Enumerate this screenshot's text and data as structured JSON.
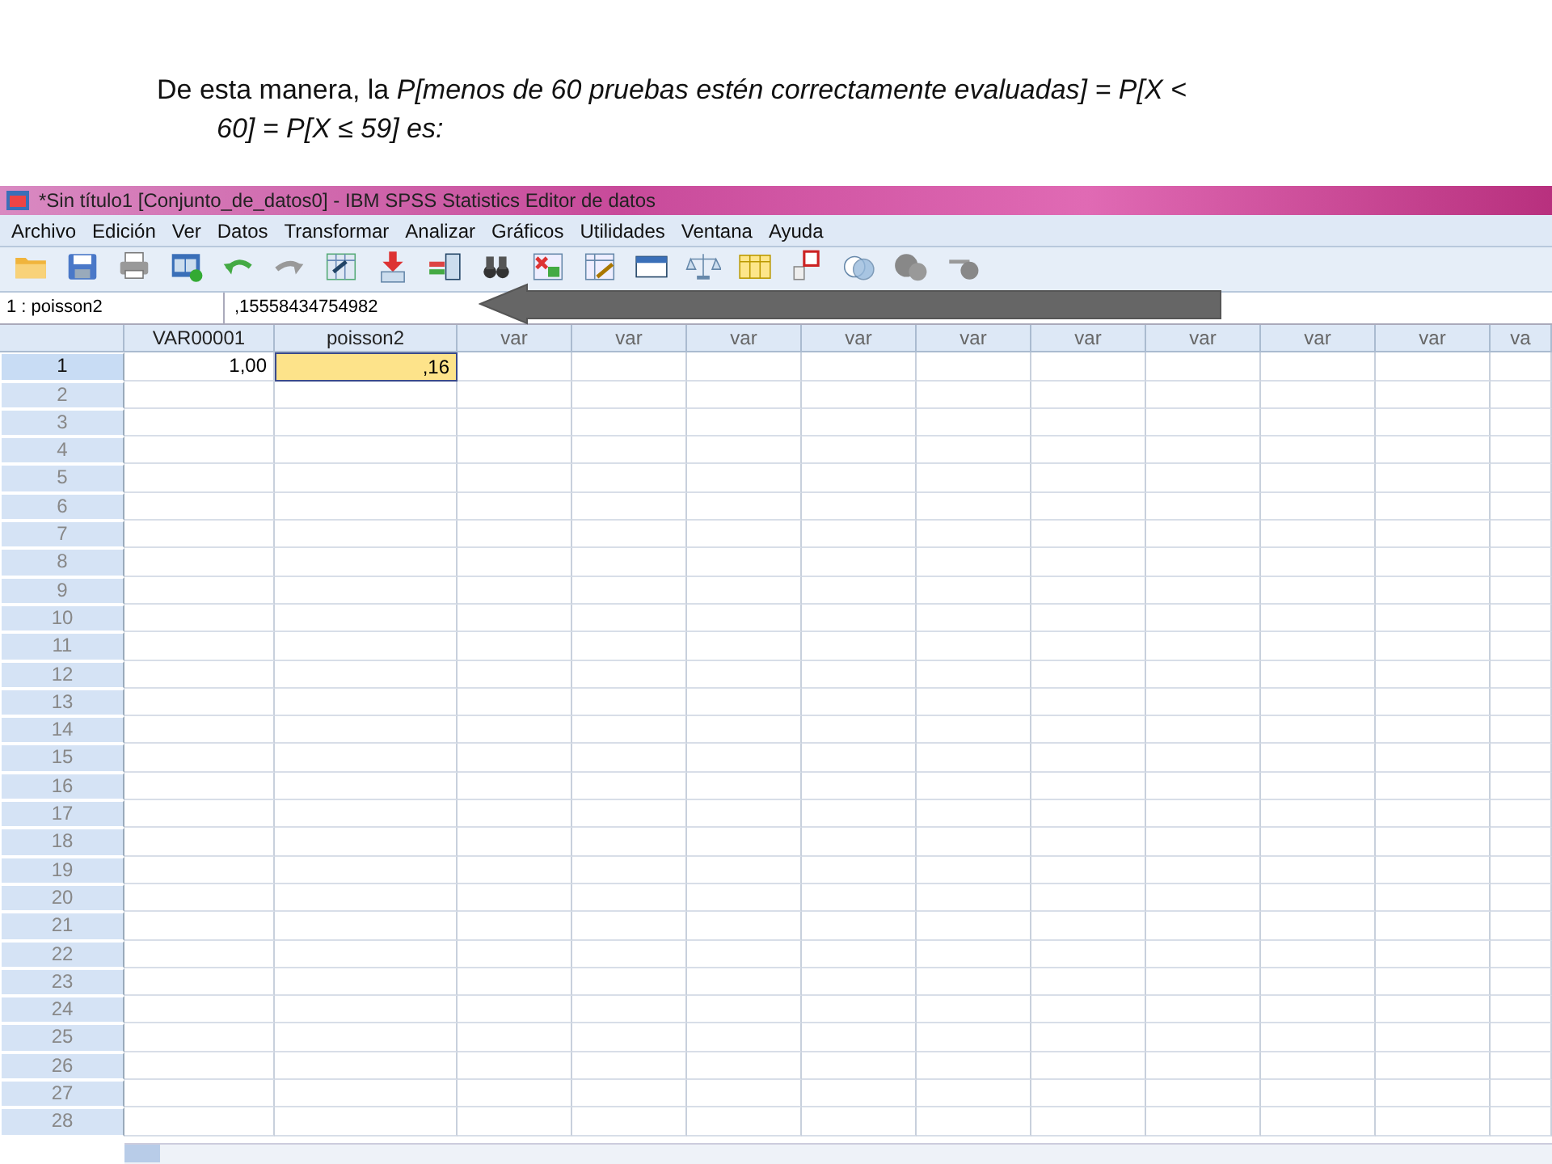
{
  "caption": "De esta manera, la *P[menos de 60 pruebas estén correctamente evaluadas] = P[X < 60] = P[X ≤ 59] es:*",
  "window": {
    "title": "*Sin título1 [Conjunto_de_datos0] - IBM SPSS Statistics Editor de datos"
  },
  "menu": [
    "Archivo",
    "Edición",
    "Ver",
    "Datos",
    "Transformar",
    "Analizar",
    "Gráficos",
    "Utilidades",
    "Ventana",
    "Ayuda"
  ],
  "cell_info": {
    "name": "1 : poisson2",
    "value": ",15558434754982"
  },
  "grid": {
    "columns": [
      "VAR00001",
      "poisson2",
      "var",
      "var",
      "var",
      "var",
      "var",
      "var",
      "var",
      "var",
      "var",
      "va"
    ],
    "rows": [
      {
        "label": "1",
        "selected": true,
        "cells": [
          {
            "value": "1,00",
            "selected": false
          },
          {
            "value": ",16",
            "selected": true
          }
        ]
      },
      {
        "label": "2",
        "selected": false
      },
      {
        "label": "3",
        "selected": false
      },
      {
        "label": "4",
        "selected": false
      },
      {
        "label": "5",
        "selected": false
      },
      {
        "label": "6",
        "selected": false
      },
      {
        "label": "7",
        "selected": false
      },
      {
        "label": "8",
        "selected": false
      },
      {
        "label": "9",
        "selected": false
      },
      {
        "label": "10",
        "selected": false
      },
      {
        "label": "11",
        "selected": false
      },
      {
        "label": "12",
        "selected": false
      },
      {
        "label": "13",
        "selected": false
      },
      {
        "label": "14",
        "selected": false
      },
      {
        "label": "15",
        "selected": false
      },
      {
        "label": "16",
        "selected": false
      },
      {
        "label": "17",
        "selected": false
      },
      {
        "label": "18",
        "selected": false
      },
      {
        "label": "19",
        "selected": false
      },
      {
        "label": "20",
        "selected": false
      },
      {
        "label": "21",
        "selected": false
      },
      {
        "label": "22",
        "selected": false
      },
      {
        "label": "23",
        "selected": false
      },
      {
        "label": "24",
        "selected": false
      },
      {
        "label": "25",
        "selected": false
      },
      {
        "label": "26",
        "selected": false
      },
      {
        "label": "27",
        "selected": false
      },
      {
        "label": "28",
        "selected": false
      }
    ]
  }
}
